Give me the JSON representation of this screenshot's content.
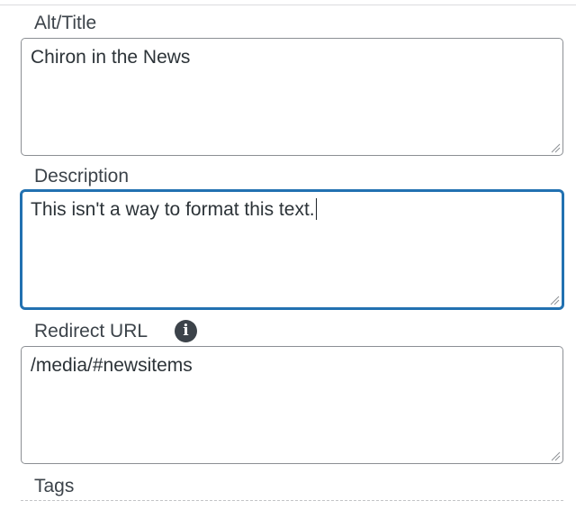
{
  "alt_title": {
    "label": "Alt/Title",
    "value": "Chiron in the News"
  },
  "description": {
    "label": "Description",
    "value": "This isn't a way to format this text."
  },
  "redirect_url": {
    "label": "Redirect URL",
    "value": "/media/#newsitems",
    "info_icon": "info-icon"
  },
  "tags": {
    "label": "Tags"
  },
  "colors": {
    "focus_border": "#2271b1",
    "field_border": "#8c8f94",
    "label_text": "#3c434a"
  }
}
